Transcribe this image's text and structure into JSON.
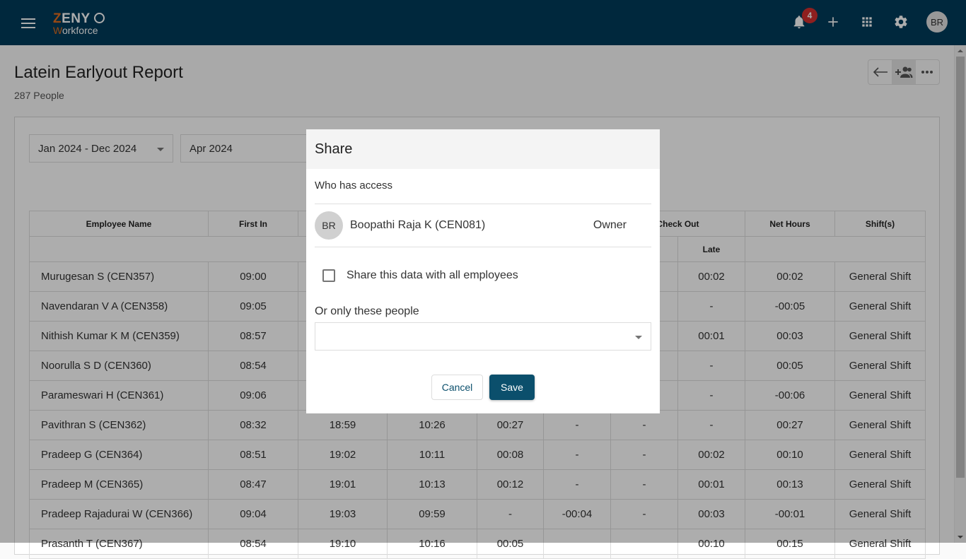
{
  "app": {
    "logo_top": "ZENY",
    "logo_bottom": "Workforce",
    "notification_count": "4",
    "user_initials": "BR"
  },
  "page": {
    "title": "Latein Earlyout Report",
    "subtitle": "287 People"
  },
  "filters": {
    "year_range": "Jan 2024 - Dec 2024",
    "month": "Apr 2024"
  },
  "table": {
    "headers": {
      "employee_name": "Employee Name",
      "first_in": "First In",
      "check_out": "Check Out",
      "check_out_late": "Late",
      "net_hours": "Net Hours",
      "shifts": "Shift(s)"
    },
    "rows": [
      {
        "name": "Murugesan S (CEN357)",
        "first_in": "09:00",
        "c3": "",
        "c4": "",
        "c5": "",
        "c6": "",
        "c7": "",
        "late": "00:02",
        "net": "00:02",
        "shift": "General Shift"
      },
      {
        "name": "Navendaran V A (CEN358)",
        "first_in": "09:05",
        "c3": "",
        "c4": "",
        "c5": "",
        "c6": "",
        "c7": "",
        "late": "-",
        "net": "-00:05",
        "shift": "General Shift"
      },
      {
        "name": "Nithish Kumar K M (CEN359)",
        "first_in": "08:57",
        "c3": "",
        "c4": "",
        "c5": "",
        "c6": "",
        "c7": "",
        "late": "00:01",
        "net": "00:03",
        "shift": "General Shift"
      },
      {
        "name": "Noorulla S D (CEN360)",
        "first_in": "08:54",
        "c3": "",
        "c4": "",
        "c5": "",
        "c6": "",
        "c7": "",
        "late": "-",
        "net": "00:05",
        "shift": "General Shift"
      },
      {
        "name": "Parameswari H (CEN361)",
        "first_in": "09:06",
        "c3": "",
        "c4": "",
        "c5": "",
        "c6": "",
        "c7": "",
        "late": "-",
        "net": "-00:06",
        "shift": "General Shift"
      },
      {
        "name": "Pavithran S (CEN362)",
        "first_in": "08:32",
        "c3": "18:59",
        "c4": "10:26",
        "c5": "00:27",
        "c6": "-",
        "c7": "-",
        "late": "-",
        "net": "00:27",
        "shift": "General Shift"
      },
      {
        "name": "Pradeep G (CEN364)",
        "first_in": "08:51",
        "c3": "19:02",
        "c4": "10:11",
        "c5": "00:08",
        "c6": "-",
        "c7": "-",
        "late": "00:02",
        "net": "00:10",
        "shift": "General Shift"
      },
      {
        "name": "Pradeep M (CEN365)",
        "first_in": "08:47",
        "c3": "19:01",
        "c4": "10:13",
        "c5": "00:12",
        "c6": "-",
        "c7": "-",
        "late": "00:01",
        "net": "00:13",
        "shift": "General Shift"
      },
      {
        "name": "Pradeep Rajadurai W (CEN366)",
        "first_in": "09:04",
        "c3": "19:03",
        "c4": "09:59",
        "c5": "-",
        "c6": "-00:04",
        "c7": "-",
        "late": "00:03",
        "net": "-00:01",
        "shift": "General Shift"
      },
      {
        "name": "Prasanth T (CEN367)",
        "first_in": "08:54",
        "c3": "19:10",
        "c4": "10:16",
        "c5": "00:05",
        "c6": "",
        "c7": "",
        "late": "00:10",
        "net": "00:15",
        "shift": "General Shift"
      }
    ]
  },
  "modal": {
    "title": "Share",
    "who_has_access": "Who has access",
    "owner_initials": "BR",
    "owner_name": "Boopathi Raja K (CEN081)",
    "owner_role": "Owner",
    "share_all_label": "Share this data with all employees",
    "share_all_checked": false,
    "only_people_label": "Or only these people",
    "people_value": "",
    "cancel_label": "Cancel",
    "save_label": "Save"
  },
  "colors": {
    "brand": "#003c5a",
    "accent": "#e06c1e",
    "positive": "#00897b",
    "negative": "#c62828",
    "primary_button": "#0b4f6c"
  }
}
